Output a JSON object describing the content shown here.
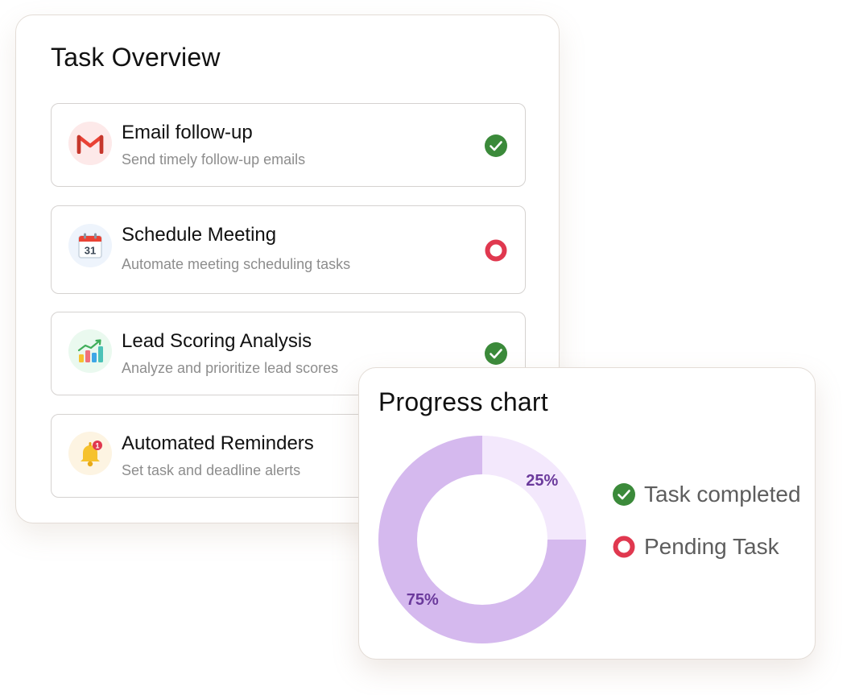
{
  "task_overview": {
    "title": "Task Overview",
    "tasks": [
      {
        "icon": "gmail-icon",
        "title": "Email follow-up",
        "description": "Send timely follow-up emails",
        "status": "completed"
      },
      {
        "icon": "calendar-icon",
        "calendar_day": "31",
        "title": "Schedule Meeting",
        "description": "Automate meeting scheduling tasks",
        "status": "pending"
      },
      {
        "icon": "bar-chart-icon",
        "title": "Lead Scoring Analysis",
        "description": "Analyze and prioritize lead scores",
        "status": "completed"
      },
      {
        "icon": "bell-icon",
        "notification_count": "1",
        "title": "Automated Reminders",
        "description": "Set task and deadline alerts",
        "status": "pending"
      }
    ]
  },
  "progress": {
    "title": "Progress chart",
    "legend": [
      {
        "label": "Task completed",
        "status": "completed"
      },
      {
        "label": "Pending Task",
        "status": "pending"
      }
    ]
  },
  "chart_data": {
    "type": "pie",
    "title": "Progress chart",
    "categories": [
      "Pending Task",
      "Task completed"
    ],
    "values": [
      25,
      75
    ],
    "labels": [
      "25%",
      "75%"
    ],
    "colors": [
      "#f3e8fc",
      "#d5b9ee"
    ],
    "label_color": "#6b3a9c",
    "legend_position": "right"
  },
  "colors": {
    "completed": "#3b8a3a",
    "pending": "#e0384f",
    "gmail_red": "#e94235",
    "calendar_red": "#ea4335",
    "calendar_bg": "#eef4fc",
    "chart_icon_bg": "#eaf9ef",
    "bell_bg": "#fdf4e2",
    "bell_yellow": "#f6c22e",
    "email_icon_bg": "#fde9e9"
  }
}
